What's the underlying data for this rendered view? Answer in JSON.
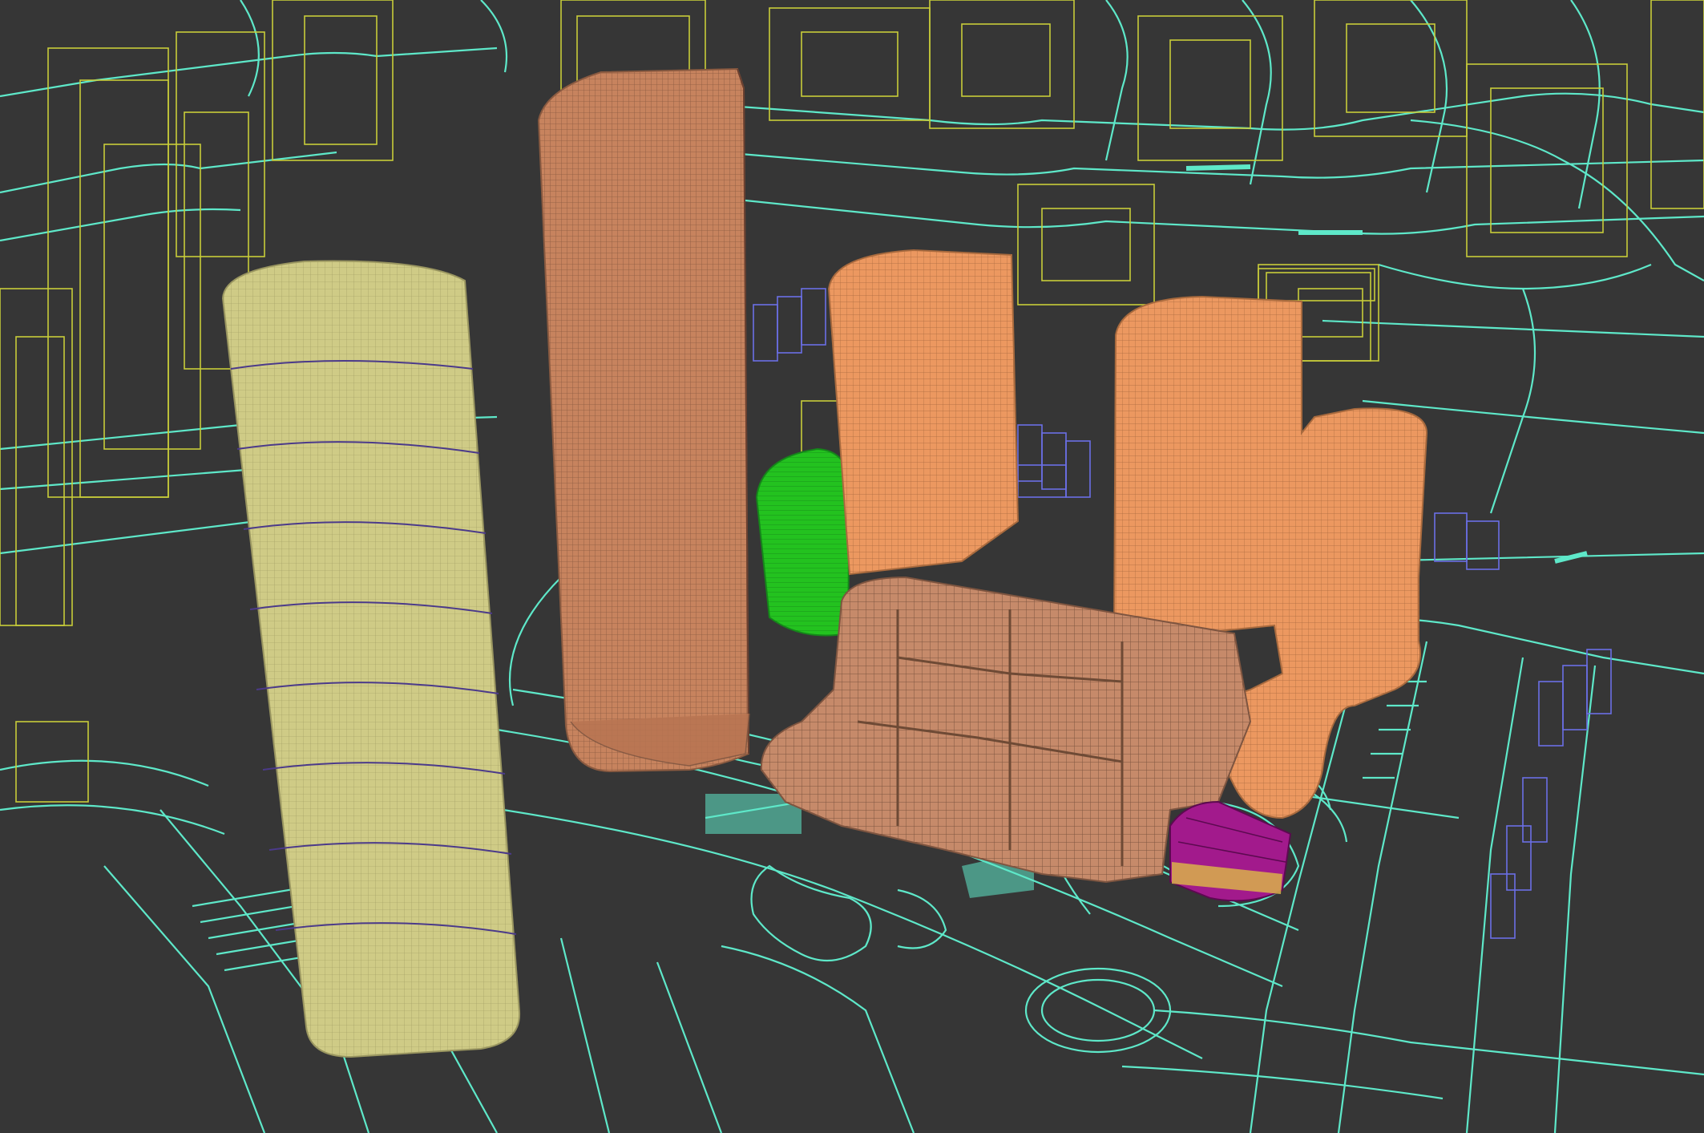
{
  "scene": {
    "kind": "3d-wireframe-viewport",
    "background_color": "#363636",
    "colors": {
      "road_lines": "#5ee8c9",
      "context_buildings": "#c8cc3a",
      "pale_tower": "#cfcb86",
      "main_tower": "#c7835e",
      "orange_towers": "#ec9860",
      "podium": "#c68a6a",
      "green_canopy": "#23c21f",
      "magenta_pavilion": "#a21a8c",
      "blue_blocks": "#6b6fe6"
    },
    "objects": [
      {
        "name": "pale-yellow-tower",
        "color_key": "pale_tower"
      },
      {
        "name": "tall-salmon-tower",
        "color_key": "main_tower"
      },
      {
        "name": "orange-tower-middle",
        "color_key": "orange_towers"
      },
      {
        "name": "orange-tower-right",
        "color_key": "orange_towers"
      },
      {
        "name": "podium-complex",
        "color_key": "podium"
      },
      {
        "name": "green-canopy",
        "color_key": "green_canopy"
      },
      {
        "name": "magenta-pavilion",
        "color_key": "magenta_pavilion"
      },
      {
        "name": "blue-block-clusters",
        "color_key": "blue_blocks"
      },
      {
        "name": "context-buildings",
        "color_key": "context_buildings"
      },
      {
        "name": "road-network",
        "color_key": "road_lines"
      }
    ]
  }
}
